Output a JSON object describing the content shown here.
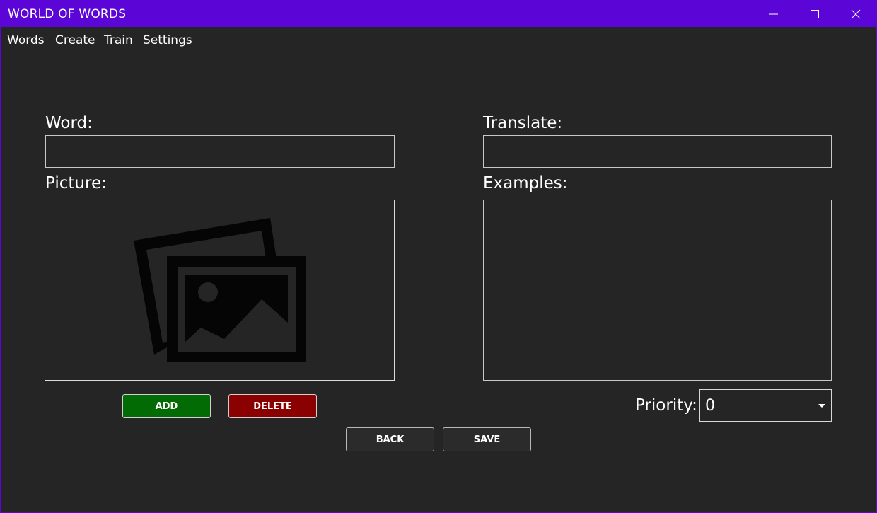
{
  "window": {
    "title": "WORLD OF WORDS",
    "accent": "#5b06d6"
  },
  "menu": [
    {
      "label": "Words"
    },
    {
      "label": "Create"
    },
    {
      "label": "Train"
    },
    {
      "label": "Settings"
    }
  ],
  "form": {
    "word_label": "Word:",
    "word_value": "",
    "translate_label": "Translate:",
    "translate_value": "",
    "picture_label": "Picture:",
    "picture_placeholder_icon": "image-placeholder-icon",
    "examples_label": "Examples:",
    "examples_value": "",
    "priority_label": "Priority:",
    "priority_value": "0"
  },
  "buttons": {
    "add": "ADD",
    "delete": "DELETE",
    "back": "BACK",
    "save": "SAVE"
  },
  "colors": {
    "background": "#252525",
    "add_button": "#036b03",
    "delete_button": "#8b0000"
  }
}
